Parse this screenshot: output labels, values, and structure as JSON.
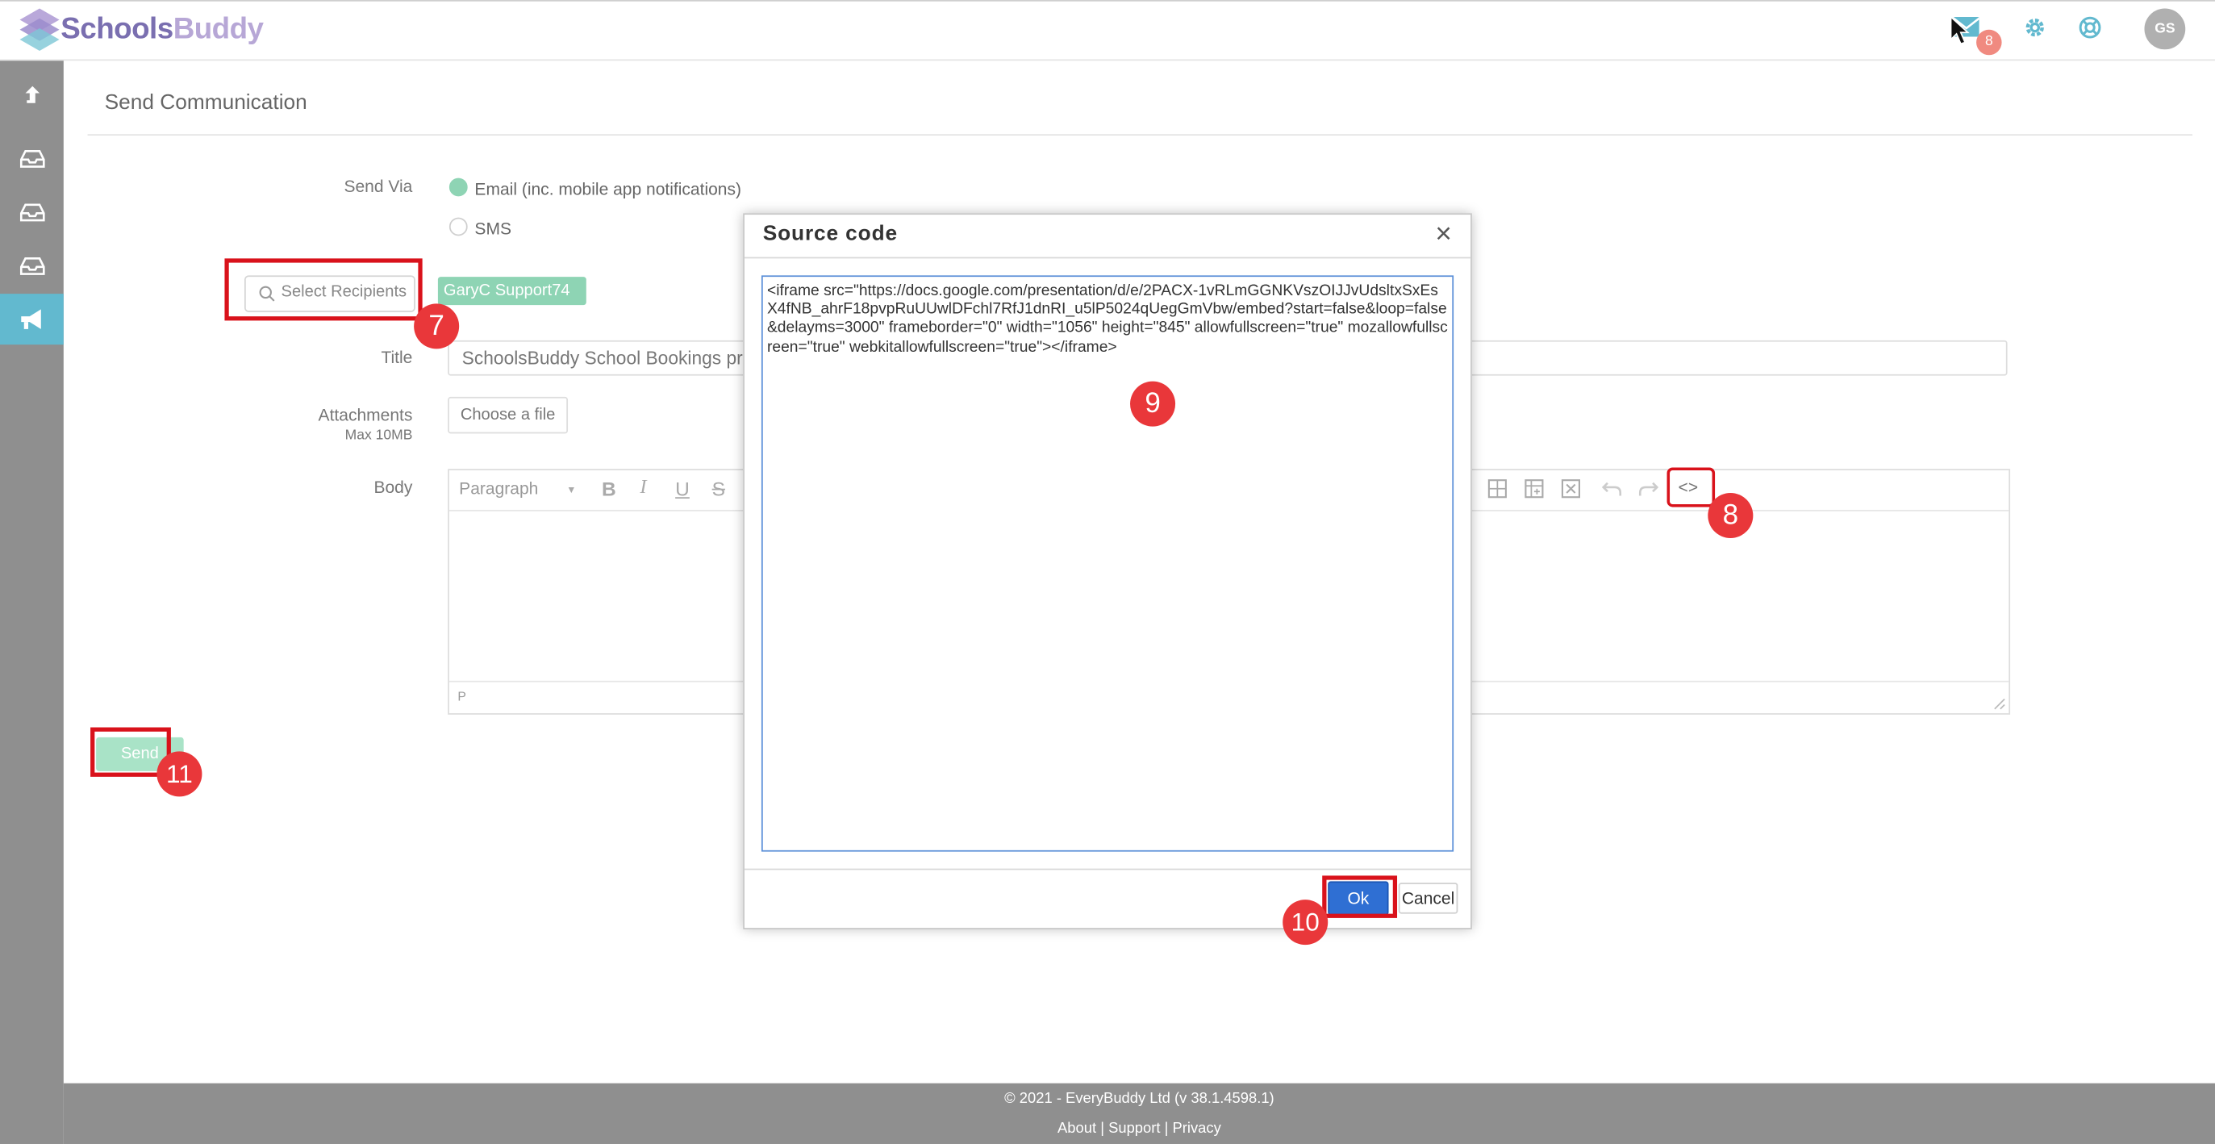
{
  "header": {
    "brand_part1": "Schools",
    "brand_part2": "Buddy",
    "mail_badge": "8",
    "avatar_initials": "GS"
  },
  "page": {
    "title": "Send Communication"
  },
  "form": {
    "send_via_label": "Send Via",
    "email_option": "Email (inc. mobile app notifications)",
    "sms_option": "SMS",
    "recipients_placeholder": "Select Recipients",
    "recipient_tag": "GaryC Support74",
    "title_label": "Title",
    "title_value": "SchoolsBuddy School Bookings pre",
    "attachments_label": "Attachments",
    "attachments_sub": "Max 10MB",
    "choose_file": "Choose a file",
    "body_label": "Body",
    "format_value": "Paragraph",
    "status_path": "P",
    "send_button": "Send"
  },
  "dialog": {
    "title": "Source code",
    "close": "×",
    "code": "<iframe src=\"https://docs.google.com/presentation/d/e/2PACX-1vRLmGGNKVszOIJJvUdsltxSxEsX4fNB_ahrF18pvpRuUUwlDFchl7RfJ1dnRI_u5lP5024qUegGmVbw/embed?start=false&loop=false&delayms=3000\" frameborder=\"0\" width=\"1056\" height=\"845\" allowfullscreen=\"true\" mozallowfullscreen=\"true\" webkitallowfullscreen=\"true\"></iframe>",
    "ok": "Ok",
    "cancel": "Cancel"
  },
  "annotations": {
    "step7": "7",
    "step8": "8",
    "step9": "9",
    "step10": "10",
    "step11": "11"
  },
  "footer": {
    "copyright": "© 2021 - EveryBuddy Ltd (v 38.1.4598.1)",
    "about": "About",
    "sep1": " | ",
    "support": "Support",
    "sep2": " | ",
    "privacy": "Privacy"
  },
  "colors": {
    "accent_green": "#8ed4b4",
    "sidebar_active": "#62b9cf",
    "annotation_red": "#e9373a",
    "ok_blue": "#2f6fd3"
  }
}
